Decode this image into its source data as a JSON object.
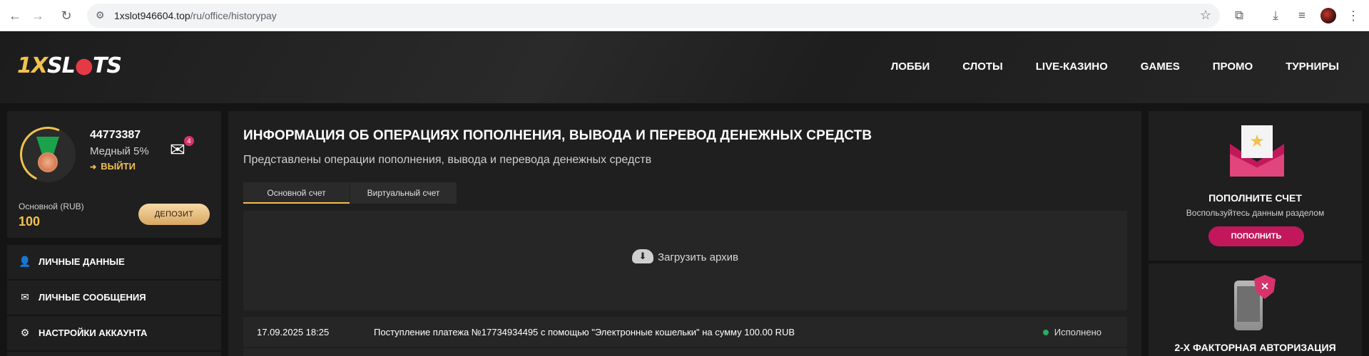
{
  "browser": {
    "url_host": "1xslot946604.top",
    "url_path": "/ru/office/historypay"
  },
  "site": {
    "logo_text_a": "1X",
    "logo_text_b": "SL",
    "logo_text_c": "TS",
    "nav": [
      "ЛОББИ",
      "СЛОТЫ",
      "LIVE-КАЗИНО",
      "GAMES",
      "ПРОМО",
      "ТУРНИРЫ"
    ]
  },
  "profile": {
    "user_id": "44773387",
    "level": "Медный 5%",
    "logout_label": "ВЫЙТИ",
    "messages_count": "4",
    "balance_label": "Основной (RUB)",
    "balance_value": "100",
    "deposit_label": "ДЕПОЗИТ"
  },
  "sidebar": {
    "items": [
      {
        "label": "ЛИЧНЫЕ ДАННЫЕ",
        "icon": "user-plus-icon"
      },
      {
        "label": "ЛИЧНЫЕ СООБЩЕНИЯ",
        "icon": "envelope-icon"
      },
      {
        "label": "НАСТРОЙКИ АККАУНТА",
        "icon": "gears-icon"
      }
    ]
  },
  "main": {
    "title": "ИНФОРМАЦИЯ ОБ ОПЕРАЦИЯХ ПОПОЛНЕНИЯ, ВЫВОДА И ПЕРЕВОД ДЕНЕЖНЫХ СРЕДСТВ",
    "subtitle": "Представлены операции пополнения, вывода и перевода денежных средств",
    "tabs": [
      {
        "label": "Основной счет",
        "active": true
      },
      {
        "label": "Виртуальный счет",
        "active": false
      }
    ],
    "archive_label": "Загрузить архив",
    "transactions": [
      {
        "date": "17.09.2025 18:25",
        "description": "Поступление платежа №17734934495 с помощью \"Электронные кошельки\" на сумму 100.00 RUB",
        "status": "Исполнено"
      }
    ]
  },
  "right": {
    "topup_title": "ПОПОЛНИТЕ СЧЕТ",
    "topup_subtitle": "Воспользуйтесь данным разделом",
    "topup_button": "ПОПОЛНИТЬ",
    "twofa_title": "2-Х ФАКТОРНАЯ АВТОРИЗАЦИЯ"
  },
  "colors": {
    "accent_gold": "#f2c14e",
    "accent_pink": "#c2185b",
    "status_green": "#27ae60"
  }
}
